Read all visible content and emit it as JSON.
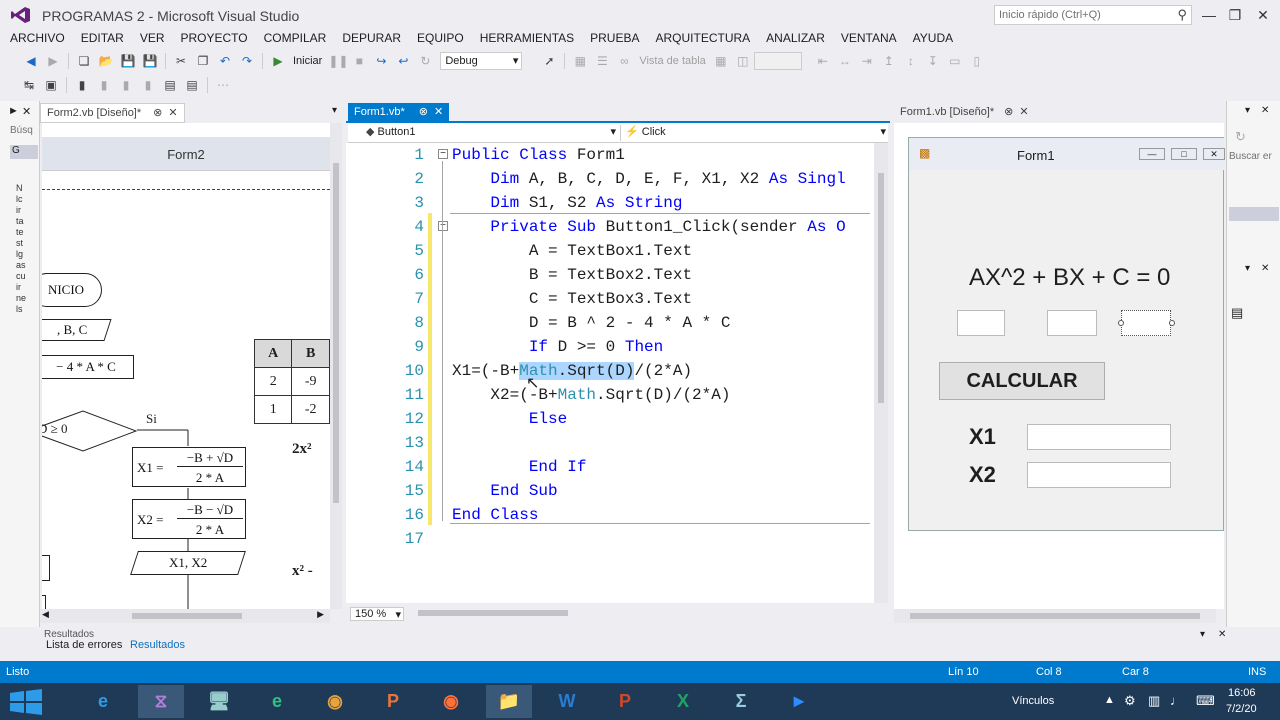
{
  "window": {
    "title": "PROGRAMAS 2 - Microsoft Visual Studio",
    "quick_launch_placeholder": "Inicio rápido (Ctrl+Q)"
  },
  "menu": [
    "ARCHIVO",
    "EDITAR",
    "VER",
    "PROYECTO",
    "COMPILAR",
    "DEPURAR",
    "EQUIPO",
    "HERRAMIENTAS",
    "PRUEBA",
    "ARQUITECTURA",
    "ANALIZAR",
    "VENTANA",
    "AYUDA"
  ],
  "toolbar": {
    "start_label": "Iniciar",
    "config_value": "Debug",
    "table_view_label": "Vista de tabla"
  },
  "left_panel": {
    "tab": "Form2.vb [Diseño]*",
    "search_label": "Búsq",
    "group_label": "G",
    "form_title": "Form2",
    "flow": {
      "start": "NICIO",
      "read": ", B, C",
      "assign": "− 4 * A * C",
      "cond": "D ≥ 0",
      "yes": "Si",
      "x1_lhs": "X1 =",
      "x1_num": "−B + √D",
      "x1_den": "2 * A",
      "x2_lhs": "X2 =",
      "x2_num": "−B − √D",
      "x2_den": "2 * A",
      "output": "X1, X2"
    },
    "table": {
      "headers": [
        "A",
        "B"
      ],
      "rows": [
        [
          "2",
          "-9"
        ],
        [
          "1",
          "-2"
        ]
      ]
    },
    "eq1": "2x²",
    "eq2": "x² -",
    "tool_letters": [
      "N",
      "lc",
      "ir",
      "ta",
      "te",
      "st",
      "lg",
      "as",
      "cu",
      "ir",
      "ne",
      "ls"
    ]
  },
  "editor": {
    "tab": "Form1.vb*",
    "class_dropdown": "Button1",
    "method_dropdown": "Click",
    "zoom": "150 %"
  },
  "code_lines": [
    {
      "n": "1",
      "segs": [
        [
          "kw",
          "Public Class "
        ],
        [
          "",
          "Form1"
        ]
      ]
    },
    {
      "n": "2",
      "segs": [
        [
          "",
          "    "
        ],
        [
          "kw",
          "Dim "
        ],
        [
          "",
          "A, B, C, D, E, F, X1, X2 "
        ],
        [
          "kw",
          "As "
        ],
        [
          "kw",
          "Singl"
        ]
      ]
    },
    {
      "n": "3",
      "segs": [
        [
          "",
          "    "
        ],
        [
          "kw",
          "Dim "
        ],
        [
          "",
          "S1, S2 "
        ],
        [
          "kw",
          "As "
        ],
        [
          "kw",
          "String"
        ]
      ]
    },
    {
      "n": "4",
      "segs": [
        [
          "",
          "    "
        ],
        [
          "kw",
          "Private Sub "
        ],
        [
          "",
          "Button1_Click(sender "
        ],
        [
          "kw",
          "As "
        ],
        [
          "kw",
          "O"
        ]
      ]
    },
    {
      "n": "5",
      "segs": [
        [
          "",
          "        A = TextBox1.Text"
        ]
      ]
    },
    {
      "n": "6",
      "segs": [
        [
          "",
          "        B = TextBox2.Text"
        ]
      ]
    },
    {
      "n": "7",
      "segs": [
        [
          "",
          "        C = TextBox3.Text"
        ]
      ]
    },
    {
      "n": "8",
      "segs": [
        [
          "",
          "        D = B ^ 2 - 4 * A * C"
        ]
      ]
    },
    {
      "n": "9",
      "segs": [
        [
          "",
          "        "
        ],
        [
          "kw",
          "If "
        ],
        [
          "",
          "D >= 0 "
        ],
        [
          "kw",
          "Then"
        ]
      ]
    },
    {
      "n": "10",
      "segs": [
        [
          "",
          "X1=(-B+"
        ],
        [
          "hlty",
          "Math"
        ],
        [
          "hl",
          ".Sqrt(D)"
        ],
        [
          "",
          "/(2*A)"
        ]
      ]
    },
    {
      "n": "11",
      "segs": [
        [
          "",
          "    X2=(-B+"
        ],
        [
          "ty",
          "Math"
        ],
        [
          "",
          ".Sqrt(D)/(2*A)"
        ]
      ]
    },
    {
      "n": "12",
      "segs": [
        [
          "",
          "        "
        ],
        [
          "kw",
          "Else"
        ]
      ]
    },
    {
      "n": "13",
      "segs": [
        [
          "",
          ""
        ]
      ]
    },
    {
      "n": "14",
      "segs": [
        [
          "",
          "        "
        ],
        [
          "kw",
          "End If"
        ]
      ]
    },
    {
      "n": "15",
      "segs": [
        [
          "",
          "    "
        ],
        [
          "kw",
          "End Sub"
        ]
      ]
    },
    {
      "n": "16",
      "segs": [
        [
          "kw",
          "End Class"
        ]
      ]
    },
    {
      "n": "17",
      "segs": [
        [
          "",
          ""
        ]
      ]
    }
  ],
  "right_panel": {
    "tab": "Form1.vb [Diseño]*",
    "form_title": "Form1",
    "equation": "AX^2 + BX + C = 0",
    "calc_button": "CALCULAR",
    "x1_label": "X1",
    "x2_label": "X2",
    "side_search": "Buscar er"
  },
  "bottom": {
    "results_header": "Resultados",
    "tab_errors": "Lista de errores",
    "tab_results": "Resultados"
  },
  "status": {
    "left": "Listo",
    "line": "Lín 10",
    "col": "Col 8",
    "car": "Car 8",
    "mode": "INS"
  },
  "taskbar": {
    "links": "Vínculos",
    "time": "16:06",
    "date": "7/2/20",
    "apps": [
      "ie-icon",
      "visual-studio-icon",
      "computer-icon",
      "edge-icon",
      "chrome-icon",
      "publisher-icon",
      "firefox-icon",
      "explorer-icon",
      "word-icon",
      "powerpoint-icon",
      "excel-icon",
      "math-icon",
      "zoom-icon"
    ]
  },
  "colors": {
    "accent": "#007acc",
    "keyword": "#0000ff",
    "type": "#2b91af"
  }
}
